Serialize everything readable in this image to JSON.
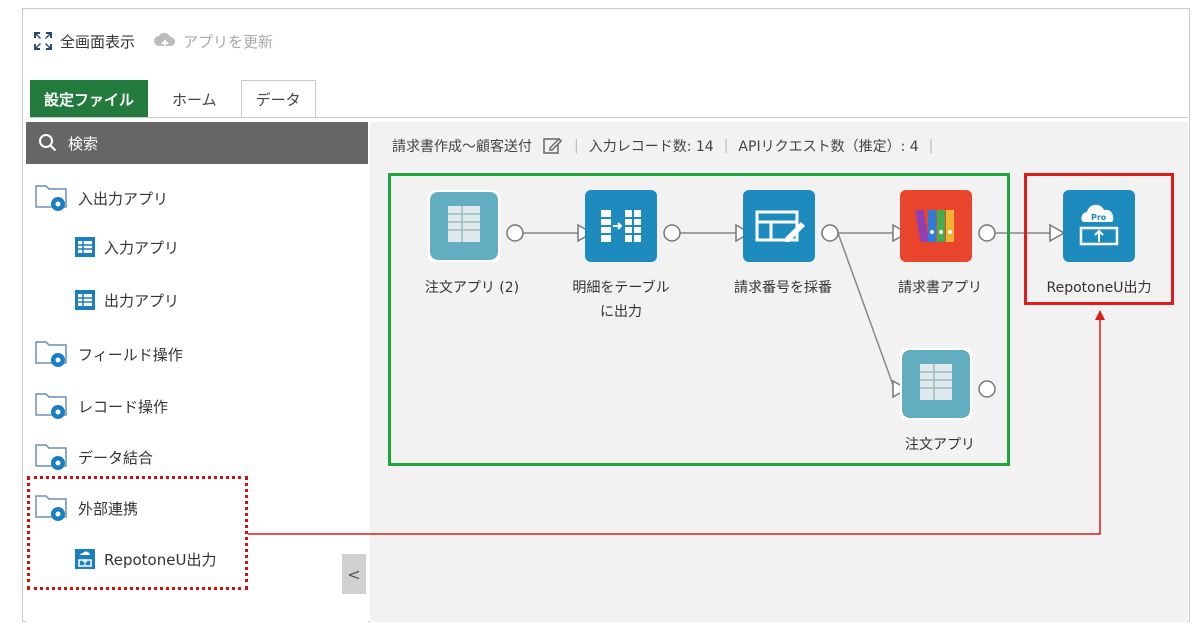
{
  "toolbar": {
    "fullscreen_label": "全画面表示",
    "update_label": "アプリを更新"
  },
  "tabs": [
    {
      "label": "設定ファイル"
    },
    {
      "label": "ホーム"
    },
    {
      "label": "データ"
    }
  ],
  "sidebar": {
    "search_label": "検索",
    "items": [
      {
        "label": "入出力アプリ"
      },
      {
        "label": "入力アプリ"
      },
      {
        "label": "出力アプリ"
      },
      {
        "label": "フィールド操作"
      },
      {
        "label": "レコード操作"
      },
      {
        "label": "データ結合"
      },
      {
        "label": "外部連携"
      },
      {
        "label": "RepotoneU出力"
      }
    ],
    "collapse_glyph": "<"
  },
  "infobar": {
    "flow_name": "請求書作成～顧客送付",
    "input_records": "入力レコード数: 14",
    "api_requests": "APIリクエスト数（推定）: 4"
  },
  "nodes": [
    {
      "label": "注文アプリ (2)"
    },
    {
      "label": "明細をテーブル"
    },
    {
      "label": "に出力"
    },
    {
      "label": "請求番号を採番"
    },
    {
      "label": "請求書アプリ"
    },
    {
      "label": "注文アプリ"
    },
    {
      "label": "RepotoneU出力"
    }
  ],
  "colors": {
    "green_tab": "#227a3c",
    "node_teal": "#1e8bbf",
    "highlight_green": "#1fa53c",
    "highlight_red": "#e01b1b"
  }
}
